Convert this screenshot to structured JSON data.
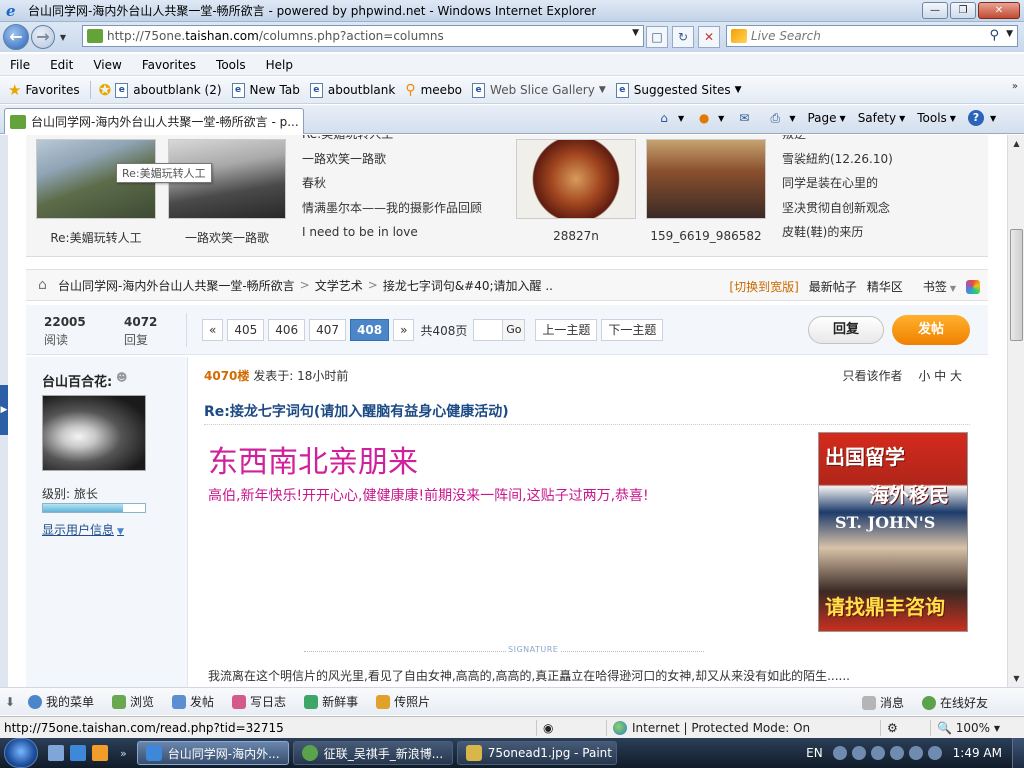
{
  "browser": {
    "window_title": "台山同学网-海内外台山人共聚一堂-畅所欲言 - powered by phpwind.net - Windows Internet Explorer",
    "address_url_prefix": "http://75one.",
    "address_url_domain": "taishan.com",
    "address_url_suffix": "/columns.php?action=columns",
    "search_placeholder": "Live Search",
    "menu": [
      "File",
      "Edit",
      "View",
      "Favorites",
      "Tools",
      "Help"
    ],
    "favorites_label": "Favorites",
    "favorites_items": [
      "aboutblank (2)",
      "New Tab",
      "aboutblank",
      "meebo",
      "Web Slice Gallery",
      "Suggested Sites"
    ],
    "tab_title": "台山同学网-海内外台山人共聚一堂-畅所欲言 - p...",
    "commands": {
      "page": "Page",
      "safety": "Safety",
      "tools": "Tools"
    },
    "status_url": "http://75one.taishan.com/read.php?tid=32715",
    "status_zone": "Internet | Protected Mode: On",
    "zoom": "100%"
  },
  "gallery": {
    "tooltip": "Re:美媚玩转人工",
    "captions": [
      "Re:美媚玩转人工",
      "一路欢笑一路歌",
      "28827n",
      "159_6619_986582"
    ],
    "list1": [
      "Re:美媚玩转人工",
      "一路欢笑一路歌",
      "春秋",
      "情满墨尔本——我的摄影作品回顾",
      "I need to be in love"
    ],
    "list2": [
      "叛逆",
      "雪裟紐約(12.26.10)",
      "同学是装在心里的",
      "坚决贯彻自创新观念",
      "皮鞋(鞋)的来历"
    ]
  },
  "breadcrumb": {
    "items": [
      "台山同学网-海内外台山人共聚一堂-畅所欲言",
      "文学艺术",
      "接龙七字词句&#40;请加入醒 .."
    ],
    "switch_width": "[切换到宽版]",
    "latest": "最新帖子",
    "digest": "精华区",
    "bookmark": "书签"
  },
  "stats": {
    "views_num": "22005",
    "views_label": "阅读",
    "replies_num": "4072",
    "replies_label": "回复"
  },
  "pager": {
    "prev": "«",
    "pages": [
      "405",
      "406",
      "407",
      "408"
    ],
    "current": "408",
    "next": "»",
    "total": "共408页",
    "go": "Go",
    "prev_topic": "上一主题",
    "next_topic": "下一主题",
    "reply": "回复",
    "post": "发帖"
  },
  "post": {
    "username": "台山百合花:",
    "level": "级别: 旅长",
    "level_progress": 0.78,
    "show_info": "显示用户信息",
    "floor": "4070楼",
    "posted_at": "发表于: 18小时前",
    "author_only": "只看该作者",
    "font_sizes": "小 中 大",
    "title": "Re:接龙七字词句(请加入醒脑有益身心健康活动)",
    "big_text": "东西南北亲朋来",
    "message": "高伯,新年快乐!开开心心,健健康康!前期没来一阵间,这贴子过两万,恭喜!",
    "signature_label": "SIGNATURE",
    "signature": "我流离在这个明信片的风光里,看见了自由女神,高高的,高高的,真正矗立在哈得逊河口的女神,却又从来没有如此的陌生......"
  },
  "ad": {
    "line1": "出国留学",
    "line2": "海外移民",
    "line3": "ST. JOHN'S",
    "line4": "请找鼎丰咨询"
  },
  "forum_toolbar": {
    "items": [
      "我的菜单",
      "浏览",
      "发帖",
      "写日志",
      "新鲜事",
      "传照片"
    ],
    "messages": "消息",
    "online_friends": "在线好友"
  },
  "taskbar": {
    "tasks": [
      "台山同学网-海内外...",
      "征联_吴祺手_新浪博...",
      "75onead1.jpg - Paint"
    ],
    "lang": "EN",
    "clock": "1:49 AM"
  }
}
